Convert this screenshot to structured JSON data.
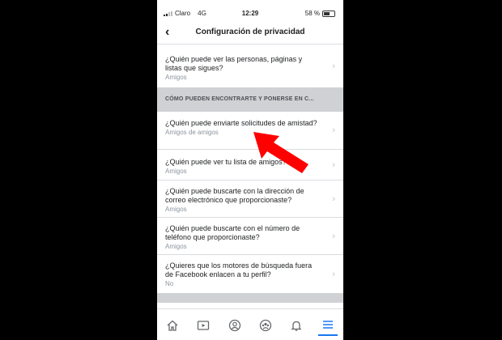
{
  "status": {
    "carrier": "Claro",
    "network": "4G",
    "time": "12:29",
    "battery": "58 %"
  },
  "nav": {
    "back_icon": "‹",
    "title": "Configuración de privacidad"
  },
  "rows": [
    {
      "q": "¿Quién puede ver las personas, páginas y listas que sigues?",
      "a": "Amigos"
    },
    {
      "q": "¿Quién puede enviarte solicitudes de amistad?",
      "a": "Amigos de amigos"
    },
    {
      "q": "¿Quién puede ver tu lista de amigos?",
      "a": "Amigos"
    },
    {
      "q": "¿Quién puede buscarte con la dirección de correo electrónico que proporcionaste?",
      "a": "Amigos"
    },
    {
      "q": "¿Quién puede buscarte con el número de teléfono que proporcionaste?",
      "a": "Amigos"
    },
    {
      "q": "¿Quieres que los motores de búsqueda fuera de Facebook enlacen a tu perfil?",
      "a": "No"
    }
  ],
  "section_header": "CÓMO PUEDEN ENCONTRARTE Y PONERSE EN C...",
  "colors": {
    "accent": "#1877f2",
    "arrow": "#ff0000"
  },
  "tabbar_icons": [
    "home-icon",
    "video-icon",
    "profile-icon",
    "groups-icon",
    "notifications-icon",
    "menu-icon"
  ]
}
